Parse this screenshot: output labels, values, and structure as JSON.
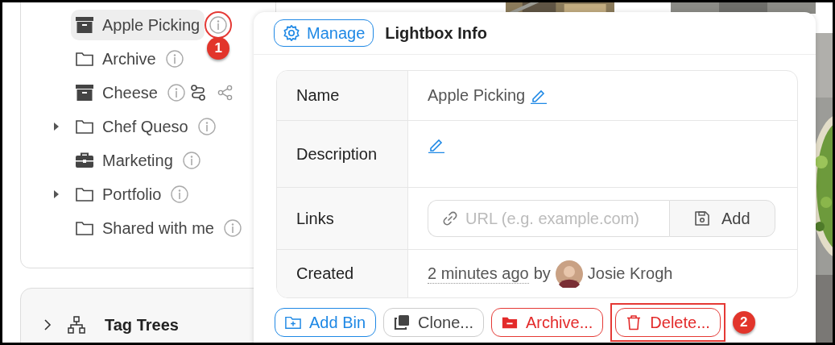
{
  "tree": [
    {
      "label": "Apple Picking",
      "kind": "archive",
      "selected": true,
      "caret": false,
      "linked": false,
      "shared": false,
      "callout": "1"
    },
    {
      "label": "Archive",
      "kind": "folder",
      "selected": false,
      "caret": false,
      "linked": false,
      "shared": false
    },
    {
      "label": "Cheese",
      "kind": "archive",
      "selected": false,
      "caret": false,
      "linked": true,
      "shared": true
    },
    {
      "label": "Chef Queso",
      "kind": "folder",
      "selected": false,
      "caret": true,
      "linked": false,
      "shared": false
    },
    {
      "label": "Marketing",
      "kind": "briefcase",
      "selected": false,
      "caret": false,
      "linked": false,
      "shared": false
    },
    {
      "label": "Portfolio",
      "kind": "folder",
      "selected": false,
      "caret": true,
      "linked": false,
      "shared": false
    },
    {
      "label": "Shared with me",
      "kind": "folder",
      "selected": false,
      "caret": false,
      "linked": false,
      "shared": false
    }
  ],
  "tag_trees": {
    "label": "Tag Trees",
    "expanded": false
  },
  "popover": {
    "manage_button": "Manage",
    "title": "Lightbox Info",
    "rows": [
      {
        "label": "Name",
        "kind": "text",
        "value": "Apple Picking"
      },
      {
        "label": "Description",
        "kind": "edit"
      },
      {
        "label": "Links",
        "kind": "link",
        "placeholder": "URL (e.g. example.com)",
        "button": "Add"
      },
      {
        "label": "Created",
        "kind": "created",
        "time": "2 minutes ago",
        "by": "by",
        "user": "Josie Krogh"
      }
    ],
    "buttons": [
      {
        "label": "Add Bin",
        "kind": "add"
      },
      {
        "label": "Clone...",
        "kind": "clone"
      },
      {
        "label": "Archive...",
        "kind": "archive"
      },
      {
        "label": "Delete...",
        "kind": "delete",
        "callout": "2"
      }
    ]
  }
}
